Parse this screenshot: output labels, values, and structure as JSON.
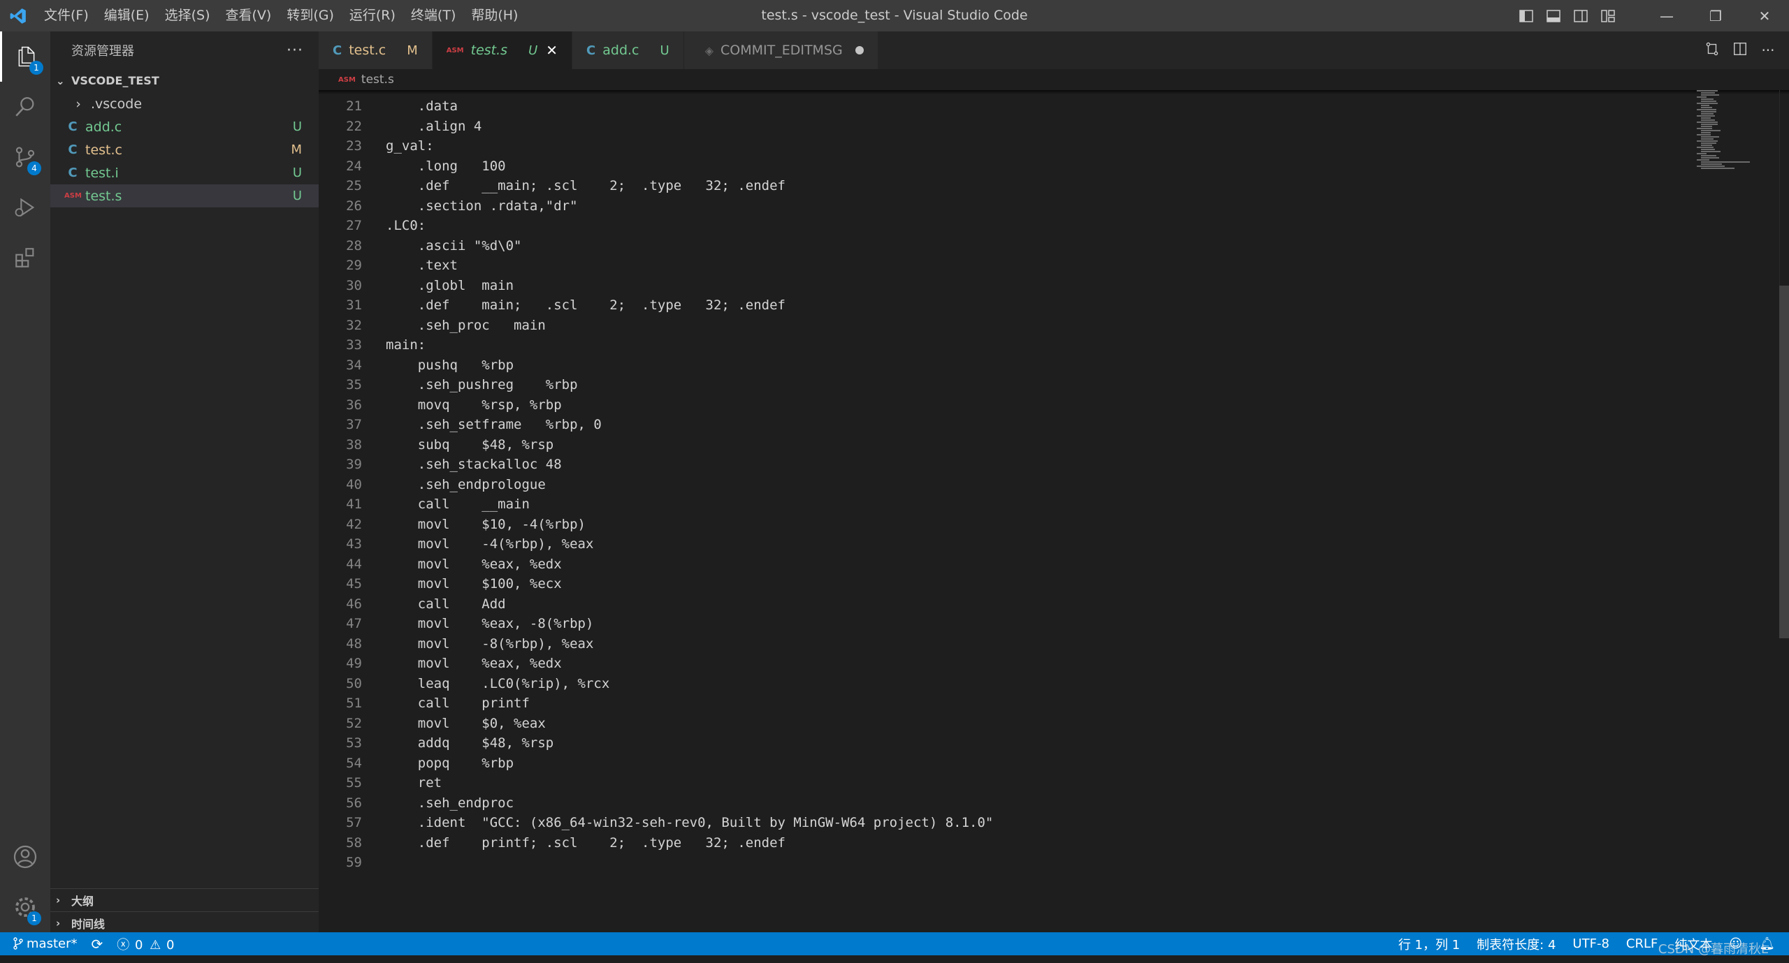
{
  "titlebar": {
    "menus": [
      "文件(F)",
      "编辑(E)",
      "选择(S)",
      "查看(V)",
      "转到(G)",
      "运行(R)",
      "终端(T)",
      "帮助(H)"
    ],
    "window_title": "test.s - vscode_test - Visual Studio Code",
    "minimize": "—",
    "restore": "❐",
    "close": "✕"
  },
  "activitybar": {
    "explorer_badge": "1",
    "scm_badge": "4",
    "settings_badge": "1"
  },
  "sidebar": {
    "header": "资源管理器",
    "more": "···",
    "folder": "VSCODE_TEST",
    "items": [
      {
        "name": ".vscode",
        "status": "",
        "type": "folder"
      },
      {
        "name": "add.c",
        "status": "U",
        "type": "c"
      },
      {
        "name": "test.c",
        "status": "M",
        "type": "c"
      },
      {
        "name": "test.i",
        "status": "U",
        "type": "c"
      },
      {
        "name": "test.s",
        "status": "U",
        "type": "asm"
      }
    ],
    "outline": "大纲",
    "timeline": "时间线"
  },
  "tabs": [
    {
      "label": "test.c",
      "status": "M"
    },
    {
      "label": "test.s",
      "status": "U"
    },
    {
      "label": "add.c",
      "status": "U"
    },
    {
      "label": "COMMIT_EDITMSG",
      "status": ""
    }
  ],
  "breadcrumb": "test.s",
  "editor": {
    "lines": [
      {
        "n": "21",
        "t": "    .data"
      },
      {
        "n": "22",
        "t": "    .align 4"
      },
      {
        "n": "23",
        "t": "g_val:"
      },
      {
        "n": "24",
        "t": "    .long   100"
      },
      {
        "n": "25",
        "t": "    .def    __main; .scl    2;  .type   32; .endef"
      },
      {
        "n": "26",
        "t": "    .section .rdata,\"dr\""
      },
      {
        "n": "27",
        "t": ".LC0:"
      },
      {
        "n": "28",
        "t": "    .ascii \"%d\\0\""
      },
      {
        "n": "29",
        "t": "    .text"
      },
      {
        "n": "30",
        "t": "    .globl  main"
      },
      {
        "n": "31",
        "t": "    .def    main;   .scl    2;  .type   32; .endef"
      },
      {
        "n": "32",
        "t": "    .seh_proc   main"
      },
      {
        "n": "33",
        "t": "main:"
      },
      {
        "n": "34",
        "t": "    pushq   %rbp"
      },
      {
        "n": "35",
        "t": "    .seh_pushreg    %rbp"
      },
      {
        "n": "36",
        "t": "    movq    %rsp, %rbp"
      },
      {
        "n": "37",
        "t": "    .seh_setframe   %rbp, 0"
      },
      {
        "n": "38",
        "t": "    subq    $48, %rsp"
      },
      {
        "n": "39",
        "t": "    .seh_stackalloc 48"
      },
      {
        "n": "40",
        "t": "    .seh_endprologue"
      },
      {
        "n": "41",
        "t": "    call    __main"
      },
      {
        "n": "42",
        "t": "    movl    $10, -4(%rbp)"
      },
      {
        "n": "43",
        "t": "    movl    -4(%rbp), %eax"
      },
      {
        "n": "44",
        "t": "    movl    %eax, %edx"
      },
      {
        "n": "45",
        "t": "    movl    $100, %ecx"
      },
      {
        "n": "46",
        "t": "    call    Add"
      },
      {
        "n": "47",
        "t": "    movl    %eax, -8(%rbp)"
      },
      {
        "n": "48",
        "t": "    movl    -8(%rbp), %eax"
      },
      {
        "n": "49",
        "t": "    movl    %eax, %edx"
      },
      {
        "n": "50",
        "t": "    leaq    .LC0(%rip), %rcx"
      },
      {
        "n": "51",
        "t": "    call    printf"
      },
      {
        "n": "52",
        "t": "    movl    $0, %eax"
      },
      {
        "n": "53",
        "t": "    addq    $48, %rsp"
      },
      {
        "n": "54",
        "t": "    popq    %rbp"
      },
      {
        "n": "55",
        "t": "    ret"
      },
      {
        "n": "56",
        "t": "    .seh_endproc"
      },
      {
        "n": "57",
        "t": "    .ident  \"GCC: (x86_64-win32-seh-rev0, Built by MinGW-W64 project) 8.1.0\""
      },
      {
        "n": "58",
        "t": "    .def    printf; .scl    2;  .type   32; .endef"
      },
      {
        "n": "59",
        "t": ""
      }
    ]
  },
  "statusbar": {
    "branch": "master*",
    "errors": "0",
    "warnings": "0",
    "position": "行 1，列 1",
    "tab_size": "制表符长度: 4",
    "encoding": "UTF-8",
    "eol": "CRLF",
    "language": "纯文本"
  },
  "watermark": "CSDN @暮雨清秋L",
  "colors": {
    "accent": "#007acc",
    "modified": "#e2c08d",
    "untracked": "#73c991",
    "c_icon": "#519aba",
    "asm_icon": "#cc3e44"
  }
}
